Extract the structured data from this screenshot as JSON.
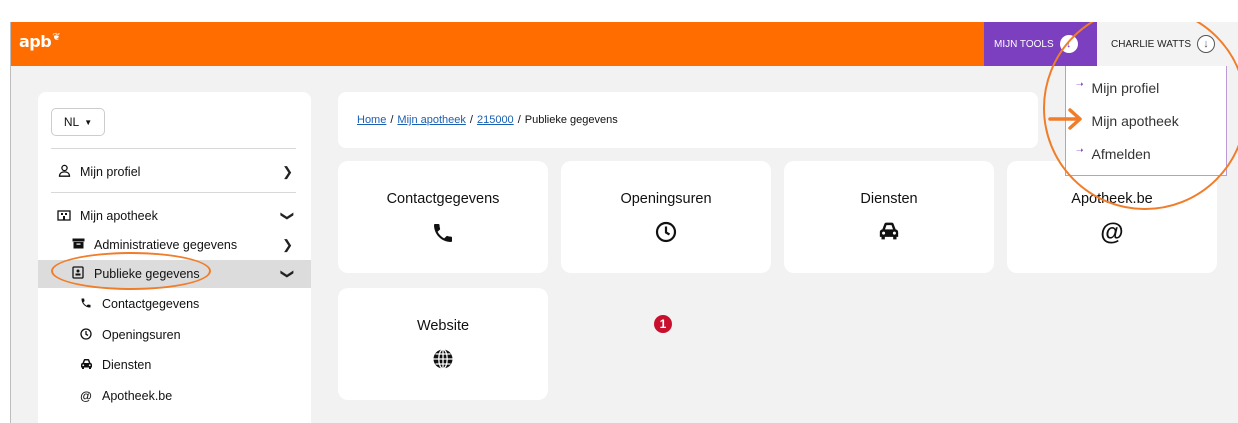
{
  "header": {
    "logo_text": "apb",
    "tools_label": "MIJN TOOLS",
    "user_label": "CHARLIE WATTS",
    "user_menu": [
      "Mijn profiel",
      "Mijn apotheek",
      "Afmelden"
    ]
  },
  "sidebar": {
    "language": "NL",
    "items": [
      {
        "label": "Mijn profiel",
        "icon": "user-icon"
      },
      {
        "label": "Mijn apotheek",
        "icon": "building-icon"
      },
      {
        "label": "Administratieve gegevens",
        "icon": "archive-icon"
      },
      {
        "label": "Publieke gegevens",
        "icon": "id-card-icon"
      },
      {
        "label": "Contactgegevens",
        "icon": "phone-icon"
      },
      {
        "label": "Openingsuren",
        "icon": "clock-icon"
      },
      {
        "label": "Diensten",
        "icon": "car-icon"
      },
      {
        "label": "Apotheek.be",
        "icon": "at-icon"
      }
    ]
  },
  "breadcrumb": {
    "items": [
      "Home",
      "Mijn apotheek",
      "215000"
    ],
    "current": "Publieke gegevens"
  },
  "tiles": [
    {
      "title": "Contactgegevens",
      "icon": "phone-icon"
    },
    {
      "title": "Openingsuren",
      "icon": "clock-icon"
    },
    {
      "title": "Diensten",
      "icon": "car-icon"
    },
    {
      "title": "Apotheek.be",
      "icon": "at-icon"
    },
    {
      "title": "Website",
      "icon": "globe-icon"
    }
  ],
  "step_badge": "1",
  "colors": {
    "brand_orange": "#ff6d00",
    "tools_purple": "#7b3fbf",
    "annotation_orange": "#f07d2a",
    "badge_red": "#c8102e",
    "link_blue": "#1a5fb4"
  }
}
